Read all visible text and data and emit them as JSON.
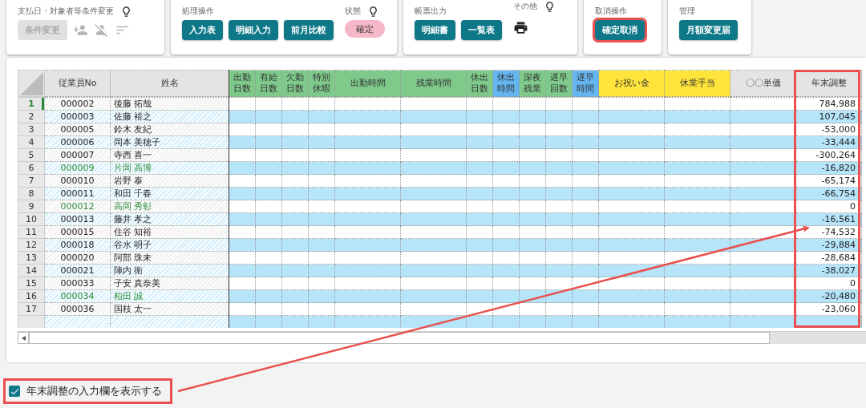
{
  "toolbar": {
    "conditions": {
      "title": "支払日・対象者等条件変更",
      "button": {
        "label": "条件変更",
        "disabled": true
      },
      "icons_disabled": true
    },
    "processing": {
      "title": "処理操作",
      "buttons": [
        {
          "label": "入力表",
          "annotated": false
        },
        {
          "label": "明細入力",
          "annotated": false
        },
        {
          "label": "前月比較",
          "annotated": false
        }
      ],
      "status_label": "状態",
      "status": "確定"
    },
    "reports": {
      "title": "帳票出力",
      "buttons": [
        {
          "label": "明細書",
          "annotated": false
        },
        {
          "label": "一覧表",
          "annotated": false
        }
      ],
      "other_label": "その他"
    },
    "cancel": {
      "title": "取消操作",
      "buttons": [
        {
          "label": "確定取消",
          "annotated": true
        }
      ]
    },
    "admin": {
      "title": "管理",
      "buttons": [
        {
          "label": "月額変更届",
          "annotated": false
        }
      ]
    }
  },
  "grid": {
    "fixed_columns": [
      "従業員No",
      "姓名"
    ],
    "columns": [
      {
        "label": "出勤日数",
        "kind": "narrow",
        "color": "#7fc98b",
        "annotated": false
      },
      {
        "label": "有給日数",
        "kind": "narrow",
        "color": "#7fc98b",
        "annotated": false
      },
      {
        "label": "欠勤日数",
        "kind": "narrow",
        "color": "#7fc98b",
        "annotated": false
      },
      {
        "label": "特別休暇",
        "kind": "narrow",
        "color": "#7fc98b",
        "annotated": false
      },
      {
        "label": "出勤時間",
        "kind": "wide",
        "color": "#7fc98b",
        "annotated": false
      },
      {
        "label": "残業時間",
        "kind": "wide",
        "color": "#7fc98b",
        "annotated": false
      },
      {
        "label": "休出日数",
        "kind": "narrow",
        "color": "#7fc98b",
        "annotated": false
      },
      {
        "label": "休出時間",
        "kind": "narrow",
        "color": "#64b5f0",
        "annotated": false
      },
      {
        "label": "深夜残業",
        "kind": "narrow",
        "color": "#7fc98b",
        "annotated": false
      },
      {
        "label": "遅早回数",
        "kind": "narrow",
        "color": "#7fc98b",
        "annotated": false
      },
      {
        "label": "遅早時間",
        "kind": "narrow",
        "color": "#64b5f0",
        "annotated": false
      },
      {
        "label": "お祝い金",
        "kind": "wide",
        "color": "#ffe53b",
        "annotated": false
      },
      {
        "label": "休業手当",
        "kind": "wide",
        "color": "#ffe53b",
        "annotated": false
      },
      {
        "label": "〇〇単価",
        "kind": "wide",
        "color": "#e4e4e4",
        "annotated": false
      },
      {
        "label": "年末調整",
        "kind": "wide",
        "color": "#e4e4e4",
        "annotated": true
      }
    ],
    "rows": [
      {
        "number": "1",
        "employee_no": "000002",
        "name": "後藤 拓哉",
        "year_end": "784,988",
        "selected": true,
        "highlighted": false
      },
      {
        "number": "2",
        "employee_no": "000003",
        "name": "佐藤 裕之",
        "year_end": "107,045",
        "selected": false,
        "highlighted": false
      },
      {
        "number": "3",
        "employee_no": "000005",
        "name": "鈴木 友紀",
        "year_end": "-53,000",
        "selected": false,
        "highlighted": false
      },
      {
        "number": "4",
        "employee_no": "000006",
        "name": "岡本 美穂子",
        "year_end": "-33,444",
        "selected": false,
        "highlighted": false
      },
      {
        "number": "5",
        "employee_no": "000007",
        "name": "寺西 喜一",
        "year_end": "-300,264",
        "selected": false,
        "highlighted": false
      },
      {
        "number": "6",
        "employee_no": "000009",
        "name": "片岡 高博",
        "year_end": "-16,820",
        "selected": false,
        "highlighted": true
      },
      {
        "number": "7",
        "employee_no": "000010",
        "name": "岩野 泰",
        "year_end": "-65,174",
        "selected": false,
        "highlighted": false
      },
      {
        "number": "8",
        "employee_no": "000011",
        "name": "和田 千春",
        "year_end": "-66,754",
        "selected": false,
        "highlighted": false
      },
      {
        "number": "9",
        "employee_no": "000012",
        "name": "高岡 秀彰",
        "year_end": "0",
        "selected": false,
        "highlighted": true
      },
      {
        "number": "10",
        "employee_no": "000013",
        "name": "藤井 孝之",
        "year_end": "-16,561",
        "selected": false,
        "highlighted": false
      },
      {
        "number": "11",
        "employee_no": "000015",
        "name": "住谷 知裕",
        "year_end": "-74,532",
        "selected": false,
        "highlighted": false
      },
      {
        "number": "12",
        "employee_no": "000018",
        "name": "谷水 明子",
        "year_end": "-29,884",
        "selected": false,
        "highlighted": false
      },
      {
        "number": "13",
        "employee_no": "000020",
        "name": "阿部 珠未",
        "year_end": "-28,684",
        "selected": false,
        "highlighted": false
      },
      {
        "number": "14",
        "employee_no": "000021",
        "name": "陣内 衛",
        "year_end": "-38,027",
        "selected": false,
        "highlighted": false
      },
      {
        "number": "15",
        "employee_no": "000033",
        "name": "子安 真奈美",
        "year_end": "0",
        "selected": false,
        "highlighted": false
      },
      {
        "number": "16",
        "employee_no": "000034",
        "name": "柏田 誠",
        "year_end": "-20,480",
        "selected": false,
        "highlighted": true
      },
      {
        "number": "17",
        "employee_no": "000036",
        "name": "国枝 太一",
        "year_end": "-23,060",
        "selected": false,
        "highlighted": false
      }
    ]
  },
  "year_end_toggle": {
    "label": "年末調整の入力欄を表示する",
    "checked": true,
    "annotated": true
  },
  "annotation_arrow": true
}
